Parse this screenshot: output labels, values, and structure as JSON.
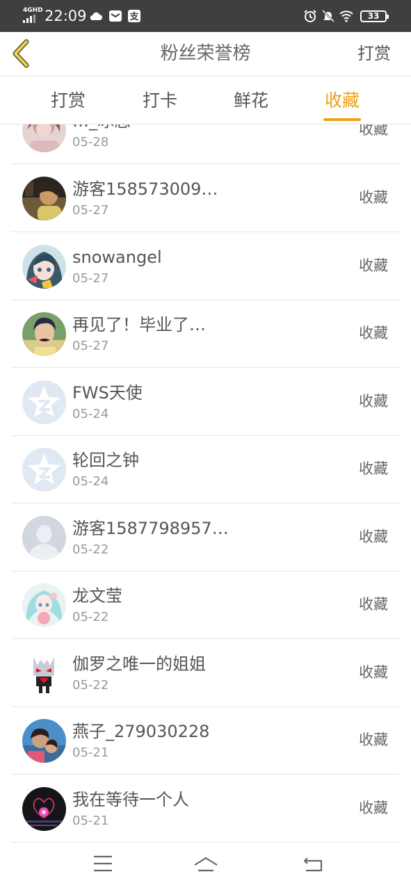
{
  "status_bar": {
    "network": "4GHD",
    "time": "22:09",
    "battery": "33",
    "icons": [
      "signal-icon",
      "cloud-icon",
      "mail-icon",
      "alipay-icon",
      "alarm-icon",
      "mute-icon",
      "wifi-icon",
      "battery-icon"
    ]
  },
  "header": {
    "title": "粉丝荣誉榜",
    "action": "打赏"
  },
  "tabs": [
    {
      "label": "打赏"
    },
    {
      "label": "打卡"
    },
    {
      "label": "鲜花"
    },
    {
      "label": "收藏"
    }
  ],
  "active_tab": "收藏",
  "accent_color": "#f0a017",
  "list": [
    {
      "name": "…_冰恋",
      "date": "05-28",
      "action": "收藏",
      "avatar": "photo-avatar"
    },
    {
      "name": "游客158573009…",
      "date": "05-27",
      "action": "收藏",
      "avatar": "photo-avatar"
    },
    {
      "name": "snowangel",
      "date": "05-27",
      "action": "收藏",
      "avatar": "anime-avatar"
    },
    {
      "name": "再见了！毕业了…",
      "date": "05-27",
      "action": "收藏",
      "avatar": "photo-avatar"
    },
    {
      "name": "FWS天使",
      "date": "05-24",
      "action": "收藏",
      "avatar": "default-star-avatar"
    },
    {
      "name": "轮回之钟",
      "date": "05-24",
      "action": "收藏",
      "avatar": "default-star-avatar"
    },
    {
      "name": "游客1587798957…",
      "date": "05-22",
      "action": "收藏",
      "avatar": "default-person-avatar"
    },
    {
      "name": "龙文莹",
      "date": "05-22",
      "action": "收藏",
      "avatar": "anime-avatar"
    },
    {
      "name": "伽罗之唯一的姐姐",
      "date": "05-22",
      "action": "收藏",
      "avatar": "cartoon-avatar"
    },
    {
      "name": "燕子_279030228",
      "date": "05-21",
      "action": "收藏",
      "avatar": "photo-avatar"
    },
    {
      "name": "我在等待一个人",
      "date": "05-21",
      "action": "收藏",
      "avatar": "dark-photo-avatar"
    }
  ],
  "nav": [
    "menu-icon",
    "home-icon",
    "back-arrow-icon"
  ]
}
